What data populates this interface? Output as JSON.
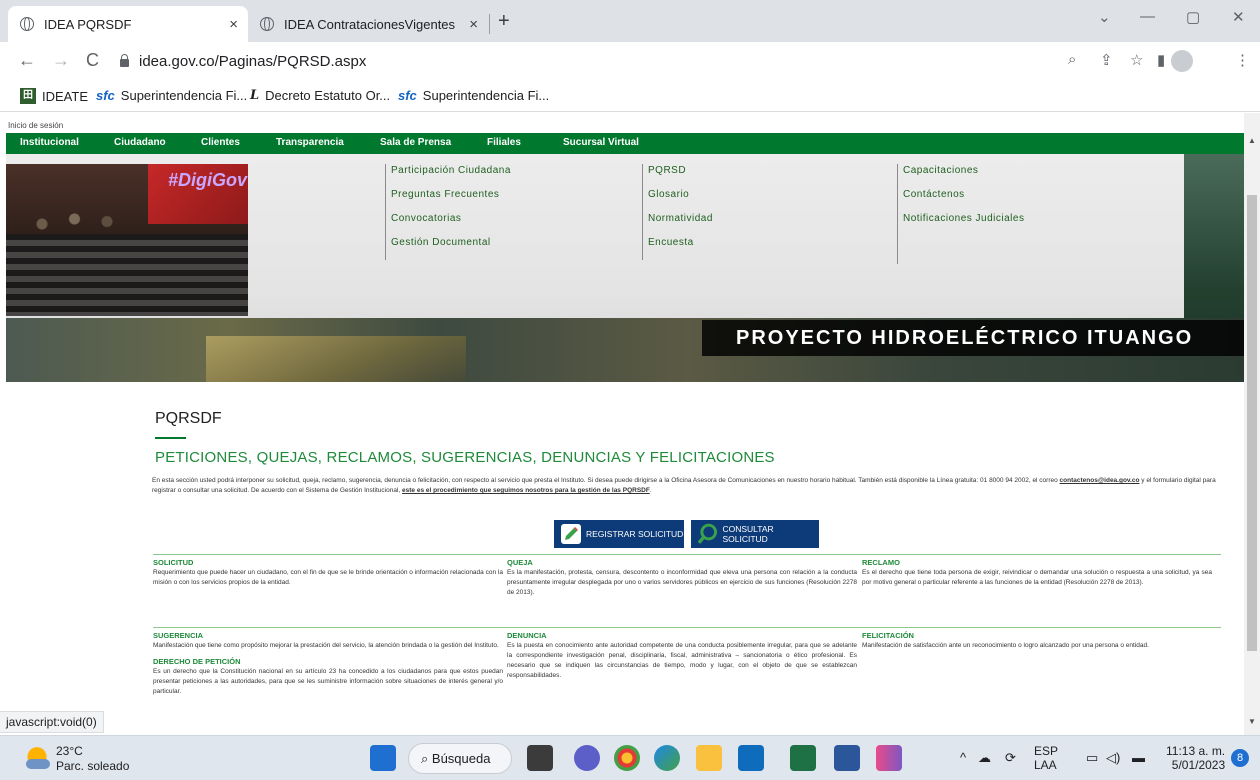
{
  "browser": {
    "tabs": [
      {
        "title": "IDEA PQRSDF",
        "close": "×"
      },
      {
        "title": "IDEA ContratacionesVigentes",
        "close": "×"
      }
    ],
    "new_tab": "+",
    "url": "idea.gov.co/Paginas/PQRSD.aspx",
    "window_controls": {
      "dropdown": "⌄",
      "minimize": "—",
      "restore": "▢",
      "close": "✕"
    },
    "nav": {
      "back": "←",
      "forward": "→",
      "reload": "C"
    },
    "toolbar_icons": {
      "zoom": "⌕",
      "share": "⇪",
      "star": "☆",
      "sidepanel": "▮",
      "menu": "⋮"
    },
    "bookmarks": [
      {
        "icon": "田",
        "label": "IDEATE"
      },
      {
        "icon": "sfc",
        "label": "Superintendencia Fi..."
      },
      {
        "icon": "L",
        "label": "Decreto Estatuto Or..."
      },
      {
        "icon": "sfc",
        "label": "Superintendencia Fi..."
      }
    ],
    "status_text": "javascript:void(0)"
  },
  "site": {
    "login": "Inicio de sesión",
    "main_nav": [
      "Institucional",
      "Ciudadano",
      "Clientes",
      "Transparencia",
      "Sala de Prensa",
      "Filiales",
      "Sucursal Virtual"
    ],
    "photo_text": "#DigiGov",
    "link_columns": [
      [
        "Participación Ciudadana",
        "Preguntas Frecuentes",
        "Convocatorias",
        "Gestión Documental"
      ],
      [
        "PQRSD",
        "Glosario",
        "Normatividad",
        "Encuesta"
      ],
      [
        "Capacitaciones",
        "Contáctenos",
        "Notificaciones Judiciales"
      ]
    ],
    "banner_text": "PROYECTO HIDROELÉCTRICO ITUANGO"
  },
  "page": {
    "title": "PQRSDF",
    "heading": "PETICIONES, QUEJAS, RECLAMOS, SUGERENCIAS, DENUNCIAS Y FELICITACIONES",
    "intro_text": "En esta sección usted podrá interponer su solicitud, queja, reclamo, sugerencia, denuncia o felicitación, con respecto al servicio que presta el Instituto. Si desea puede dirigirse a la Oficina Asesora de Comunicaciones en nuestro horario habitual. También está disponible la Línea gratuita: 01 8000 94 2002, el correo ",
    "intro_email": "contactenos@idea.gov.co",
    "intro_text2": " y el formulario digital para registrar o consultar una solicitud. De acuerdo con el Sistema de Gestión Institucional, ",
    "intro_link": "este es el procedimiento que seguimos nosotros para la gestión de las PQRSDF",
    "intro_end": ".",
    "buttons": {
      "register": "REGISTRAR SOLICITUD",
      "consult": "CONSULTAR SOLICITUD"
    },
    "definitions": [
      {
        "title": "SOLICITUD",
        "text": "Requerimiento que puede hacer un ciudadano, con el fin de que se le brinde orientación o información relacionada con la misión o con los servicios propios de la entidad."
      },
      {
        "title": "QUEJA",
        "text": "Es la manifestación, protesta, censura, descontento o inconformidad que eleva una persona con relación a la conducta presuntamente irregular desplegada por uno o varios servidores públicos en ejercicio de sus funciones (Resolución 2278 de 2013)."
      },
      {
        "title": "RECLAMO",
        "text": "Es el derecho que tiene toda persona de exigir, reivindicar o demandar una solución o respuesta a una solicitud, ya sea por motivo general o particular referente a las funciones de la entidad (Resolución 2278 de 2013)."
      },
      {
        "title": "SUGERENCIA",
        "text": "Manifestación que tiene como propósito mejorar la prestación del servicio, la atención brindada o la gestión del Instituto."
      },
      {
        "title": "DENUNCIA",
        "text": "Es la puesta en conocimiento ante autoridad competente de una conducta posiblemente irregular, para que se adelante la correspondiente investigación penal, disciplinaria, fiscal, administrativa – sancionatoria o ético profesional. Es necesario que se indiquen las circunstancias de tiempo, modo y lugar, con el objeto de que se establezcan responsabilidades."
      },
      {
        "title": "FELICITACIÓN",
        "text": "Manifestación de satisfacción ante un reconocimiento o logro alcanzado por una persona o entidad."
      },
      {
        "title": "DERECHO DE PETICIÓN",
        "text": "Es un derecho que la Constitución nacional en su artículo 23 ha concedido a los ciudadanos para que estos puedan presentar peticiones a las autoridades, para que se les suministre información sobre situaciones de interés general y/o particular."
      }
    ]
  },
  "taskbar": {
    "temperature": "23°C",
    "condition": "Parc. soleado",
    "search": "Búsqueda",
    "lang_top": "ESP",
    "lang_bottom": "LAA",
    "time": "11:13 a. m.",
    "date": "5/01/2023",
    "notifications": "8"
  }
}
